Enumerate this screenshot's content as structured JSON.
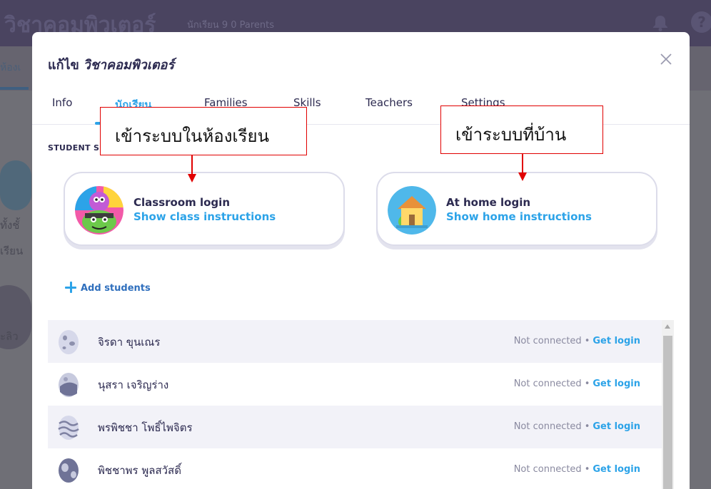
{
  "background": {
    "class_title": "วิชาคอมพิวเตอร์",
    "meta": "นักเรียน 9   0 Parents",
    "subtab": "ห้องเ",
    "side_text_1": "ทั้งชั้\nเรียน",
    "side_text_2": "ะลิว"
  },
  "modal": {
    "title_lead": "แก้ไข",
    "title_class": "วิชาคอมพิวเตอร์",
    "close_icon": "close-icon",
    "tabs": [
      {
        "label": "Info",
        "active": false
      },
      {
        "label": "นักเรียน",
        "active": true
      },
      {
        "label": "Families",
        "active": false
      },
      {
        "label": "Skills",
        "active": false
      },
      {
        "label": "Teachers",
        "active": false
      },
      {
        "label": "Settings",
        "active": false
      }
    ],
    "section_label": "STUDENT S",
    "login_cards": {
      "classroom": {
        "title": "Classroom login",
        "link": "Show class instructions",
        "icon": "monsters-icon"
      },
      "home": {
        "title": "At home login",
        "link": "Show home instructions",
        "icon": "house-icon"
      }
    },
    "add_students": "Add students",
    "students": [
      {
        "name": "จิรดา ขุนเณร",
        "status": "Not connected",
        "action": "Get login",
        "avatar": "egg-icon"
      },
      {
        "name": "นุสรา เจริญร่าง",
        "status": "Not connected",
        "action": "Get login",
        "avatar": "egg-icon"
      },
      {
        "name": "พรพิชชา โพธิ์ไพจิตร",
        "status": "Not connected",
        "action": "Get login",
        "avatar": "egg-icon"
      },
      {
        "name": "พิชชาพร พูลสวัสดิ์",
        "status": "Not connected",
        "action": "Get login",
        "avatar": "egg-icon"
      }
    ]
  },
  "annotations": {
    "classroom_label": "เข้าระบบในห้องเรียน",
    "home_label": "เข้าระบบที่บ้าน"
  },
  "colors": {
    "accent": "#2ca3e8",
    "annotation": "#e10000",
    "text": "#2c2a50"
  }
}
